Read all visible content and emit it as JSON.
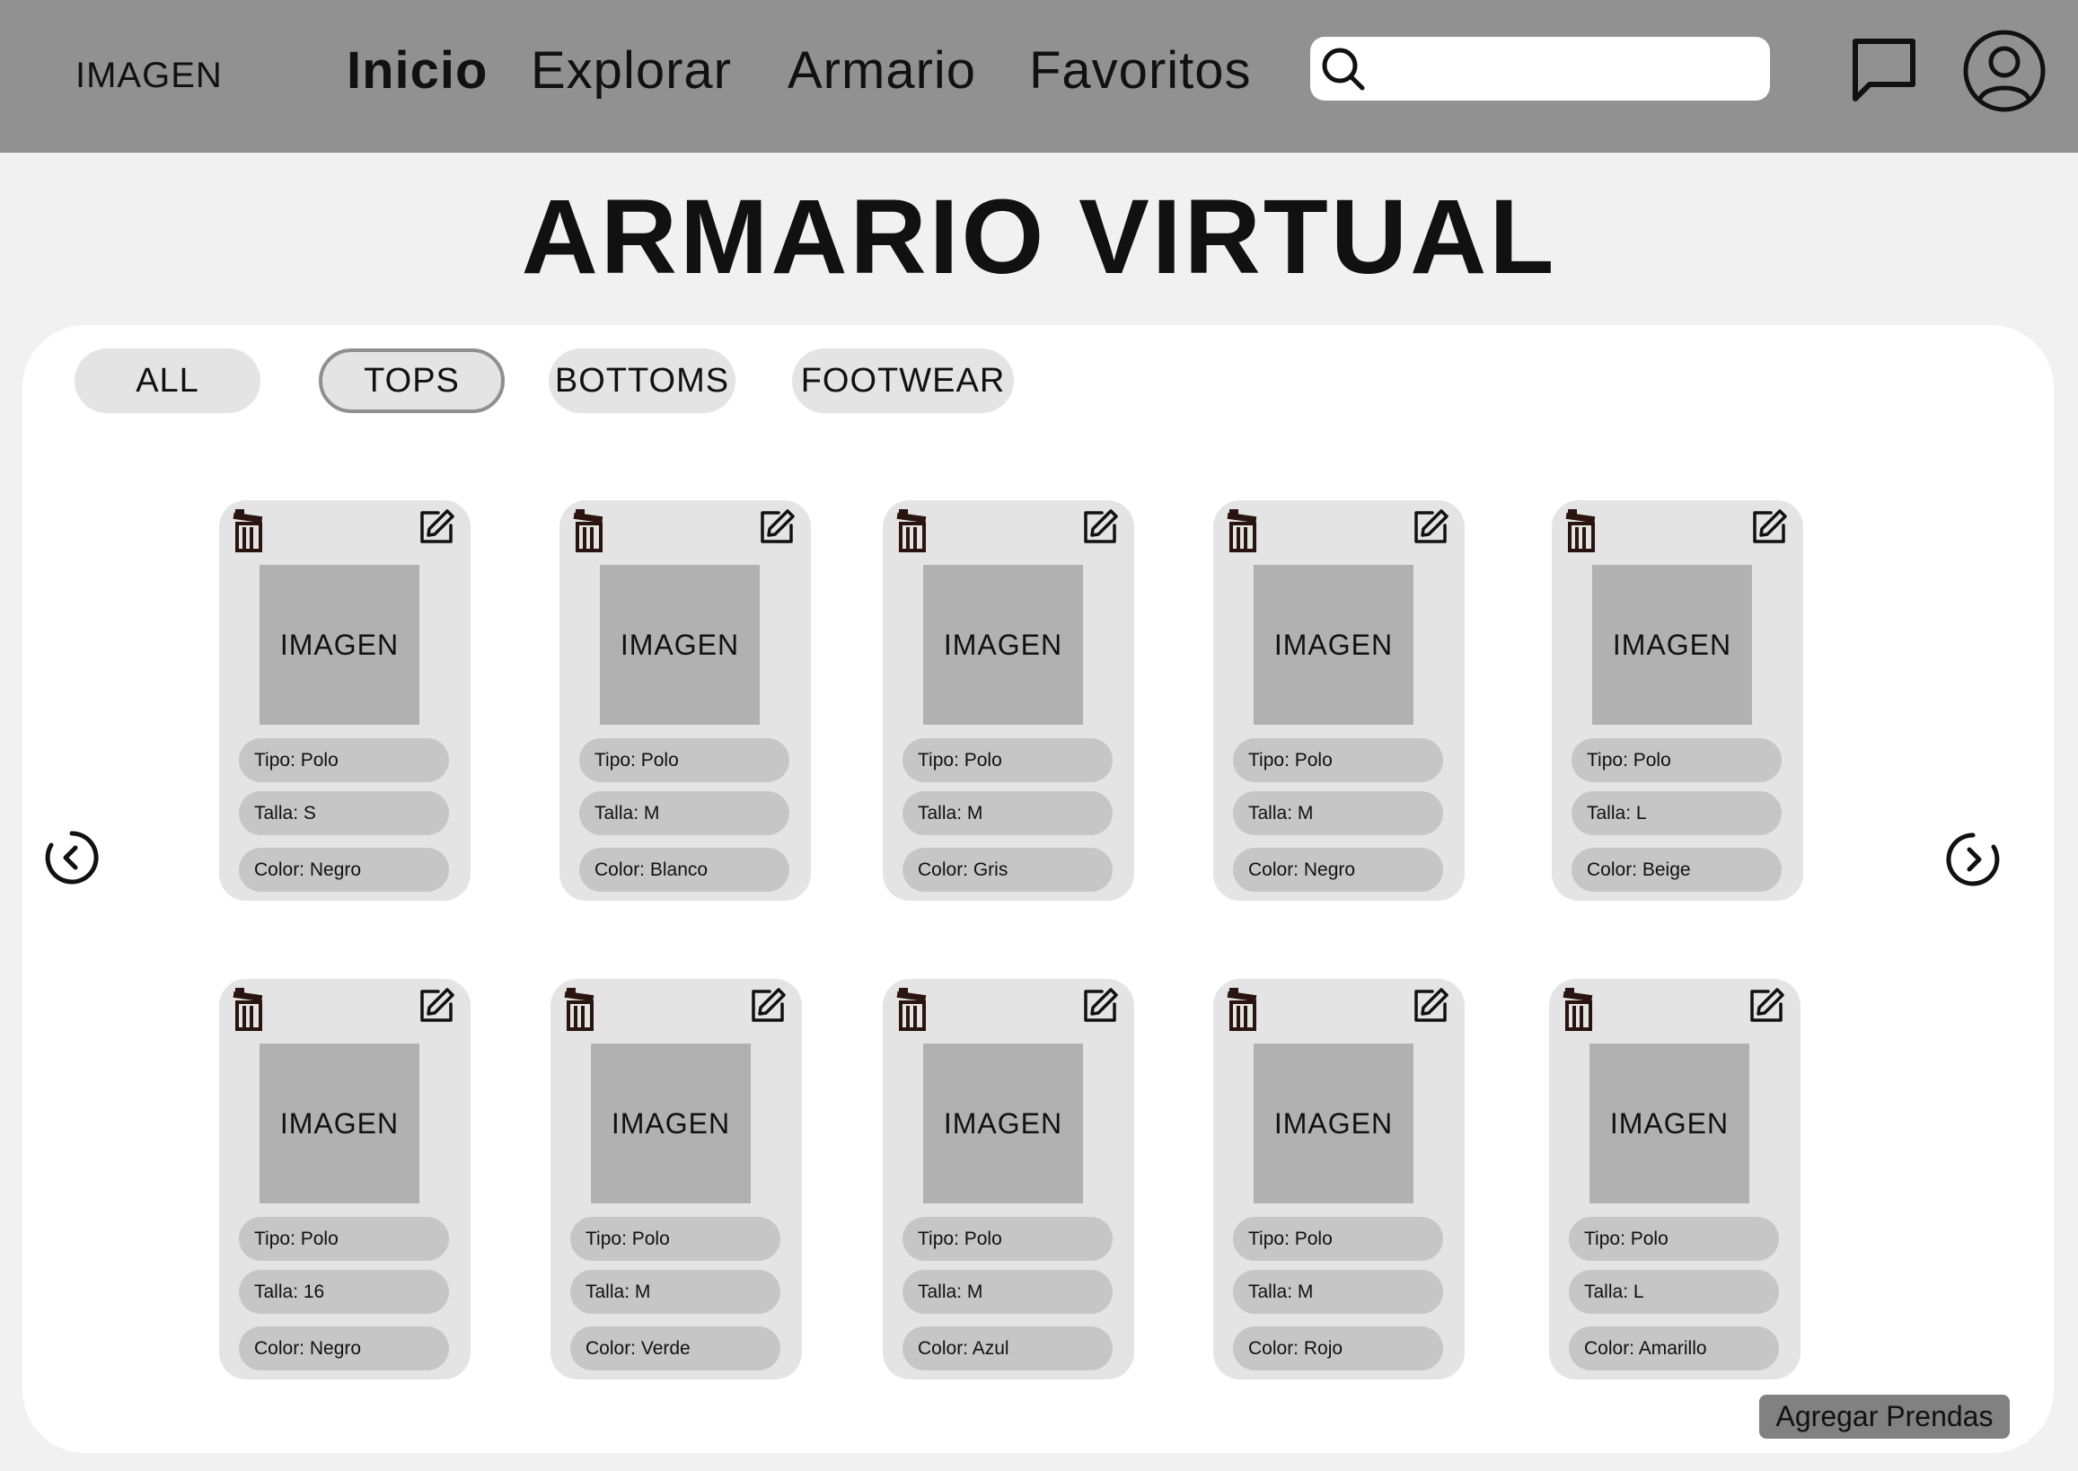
{
  "header": {
    "logo": "IMAGEN",
    "nav": [
      "Inicio",
      "Explorar",
      "Armario",
      "Favoritos"
    ],
    "active_nav": "Inicio",
    "search": {
      "value": "",
      "placeholder": ""
    },
    "icons": {
      "search": "search-icon",
      "chat": "chat-icon",
      "profile": "user-profile-icon"
    }
  },
  "page": {
    "title": "ARMARIO VIRTUAL"
  },
  "filters": {
    "all": "ALL",
    "tops": "TOPS",
    "bottoms": "BOTTOMS",
    "footwear": "FOOTWEAR",
    "selected": "TOPS"
  },
  "carousel": {
    "prev_icon": "chevron-left-circle-icon",
    "next_icon": "chevron-right-circle-icon"
  },
  "cards": [
    {
      "image_label": "IMAGEN",
      "tipo": "Tipo: Polo",
      "talla": "Talla: S",
      "color": "Color: Negro"
    },
    {
      "image_label": "IMAGEN",
      "tipo": "Tipo: Polo",
      "talla": "Talla: M",
      "color": "Color: Blanco"
    },
    {
      "image_label": "IMAGEN",
      "tipo": "Tipo: Polo",
      "talla": "Talla: M",
      "color": "Color: Gris"
    },
    {
      "image_label": "IMAGEN",
      "tipo": "Tipo: Polo",
      "talla": "Talla: M",
      "color": "Color: Negro"
    },
    {
      "image_label": "IMAGEN",
      "tipo": "Tipo: Polo",
      "talla": "Talla: L",
      "color": "Color: Beige"
    },
    {
      "image_label": "IMAGEN",
      "tipo": "Tipo: Polo",
      "talla": "Talla: 16",
      "color": "Color: Negro"
    },
    {
      "image_label": "IMAGEN",
      "tipo": "Tipo: Polo",
      "talla": "Talla: M",
      "color": "Color: Verde"
    },
    {
      "image_label": "IMAGEN",
      "tipo": "Tipo: Polo",
      "talla": "Talla: M",
      "color": "Color: Azul"
    },
    {
      "image_label": "IMAGEN",
      "tipo": "Tipo: Polo",
      "talla": "Talla: M",
      "color": "Color: Rojo"
    },
    {
      "image_label": "IMAGEN",
      "tipo": "Tipo: Polo",
      "talla": "Talla: L",
      "color": "Color: Amarillo"
    }
  ],
  "actions": {
    "add_label": "Agregar Prendas"
  },
  "colors": {
    "header_bg": "#919191",
    "page_bg": "#f1f1f1",
    "card_bg": "#e4e4e4",
    "pill_bg": "#c6c6c6",
    "image_bg": "#b1b1b1",
    "add_button_bg": "#818181"
  }
}
